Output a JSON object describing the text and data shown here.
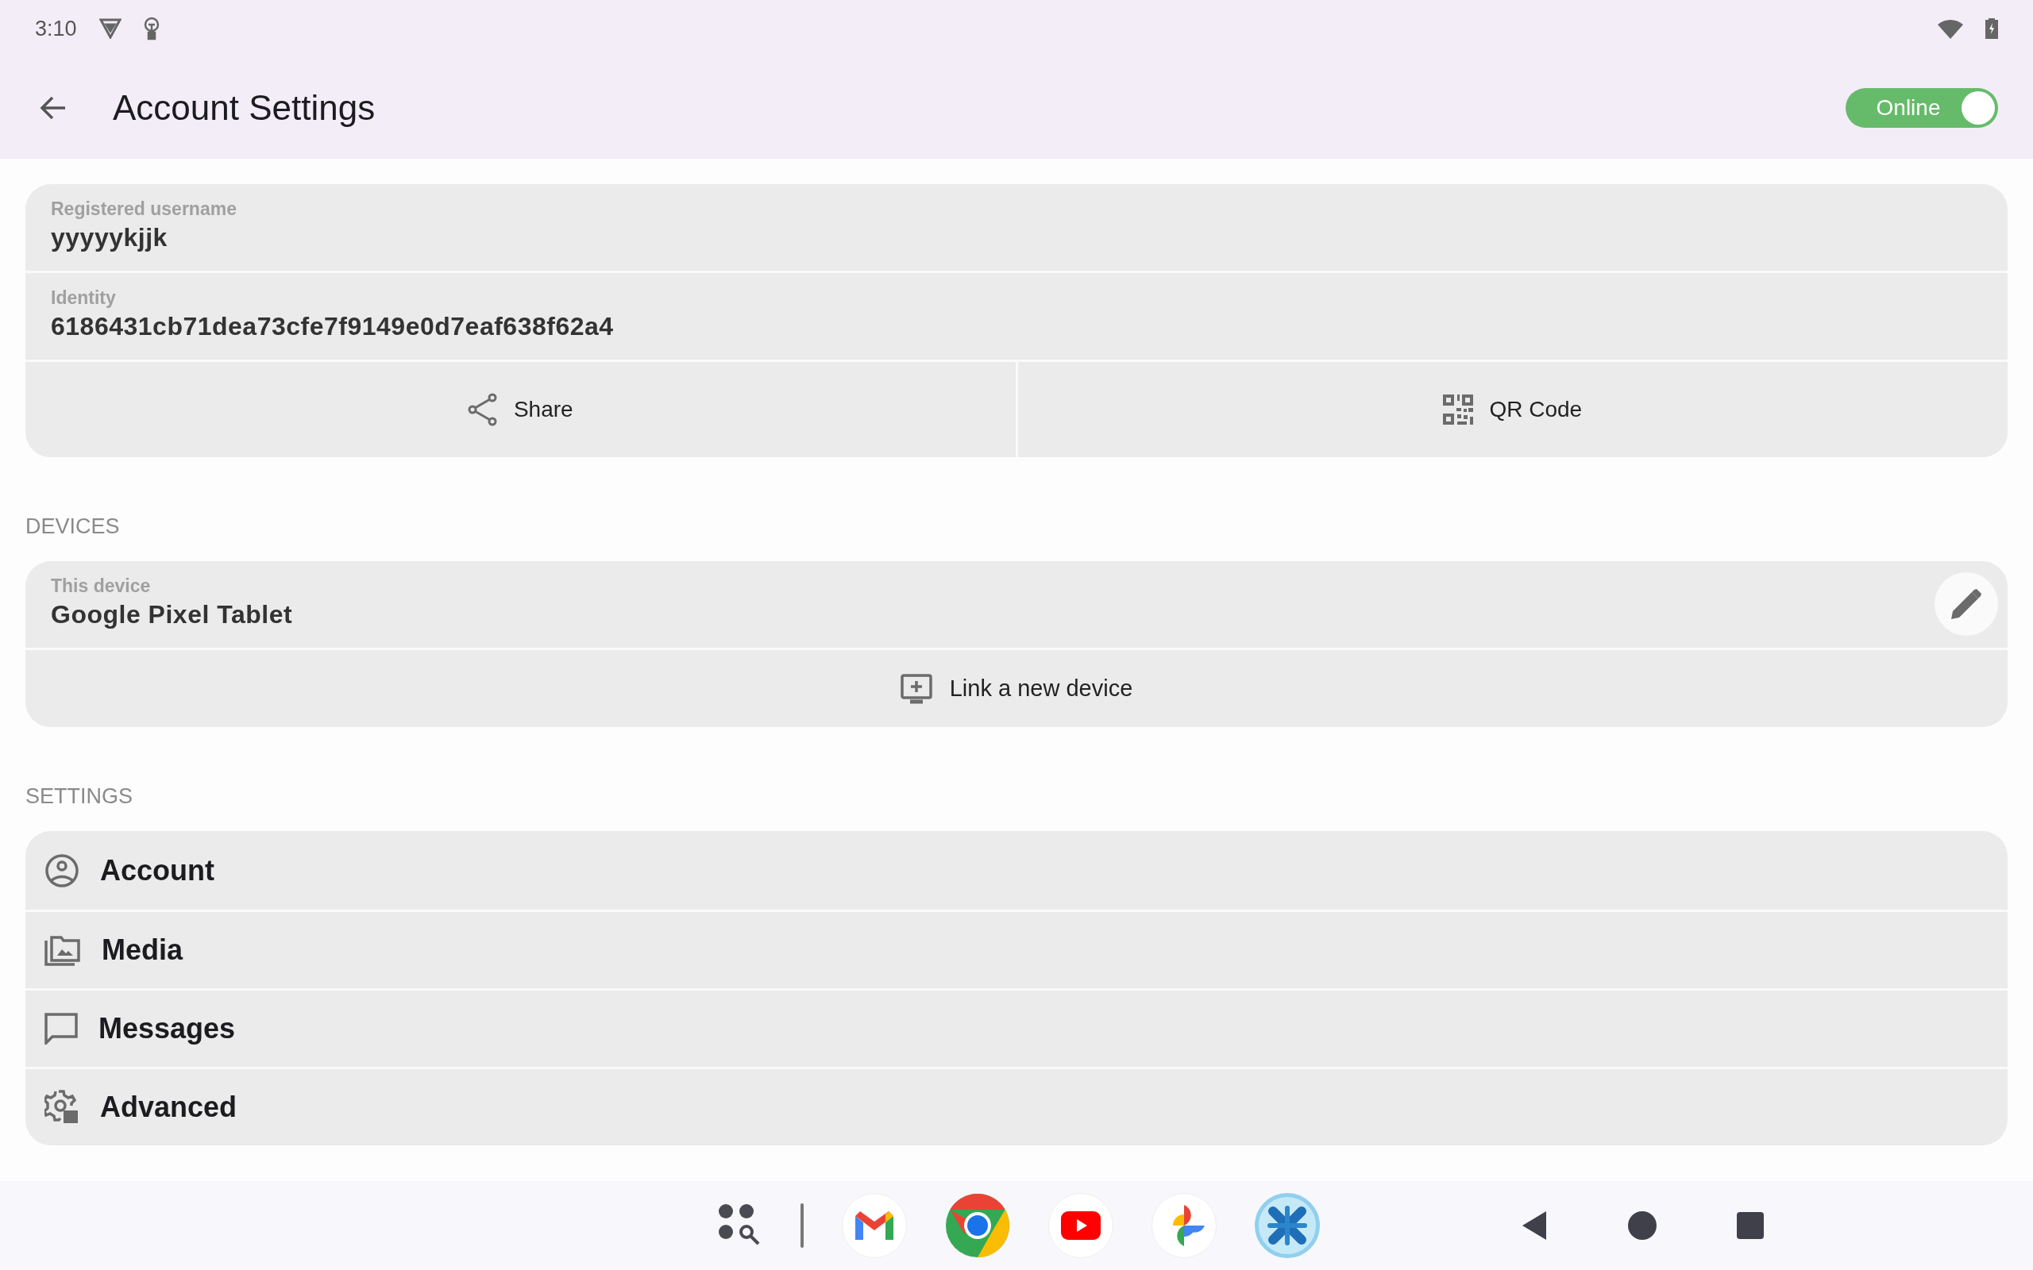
{
  "status_bar": {
    "time": "3:10"
  },
  "header": {
    "title": "Account Settings",
    "status_toggle": {
      "label": "Online",
      "on": true
    }
  },
  "account_card": {
    "fields": [
      {
        "label": "Registered username",
        "value": "yyyyykjjk"
      },
      {
        "label": "Identity",
        "value": "6186431cb71dea73cfe7f9149e0d7eaf638f62a4"
      }
    ],
    "actions": [
      {
        "label": "Share",
        "kind": "share"
      },
      {
        "label": "QR Code",
        "kind": "qr"
      }
    ]
  },
  "devices": {
    "heading": "DEVICES",
    "device": {
      "label": "This device",
      "value": "Google Pixel Tablet"
    },
    "link_action": "Link a new device"
  },
  "settings": {
    "heading": "SETTINGS",
    "items": [
      {
        "label": "Account",
        "kind": "account"
      },
      {
        "label": "Media",
        "kind": "media"
      },
      {
        "label": "Messages",
        "kind": "messages"
      },
      {
        "label": "Advanced",
        "kind": "advanced"
      }
    ]
  },
  "taskbar": {
    "apps": [
      {
        "kind": "mail",
        "selected": false
      },
      {
        "kind": "browser",
        "selected": false
      },
      {
        "kind": "video",
        "selected": false
      },
      {
        "kind": "photos",
        "selected": false
      },
      {
        "kind": "messenger",
        "selected": true
      }
    ]
  }
}
